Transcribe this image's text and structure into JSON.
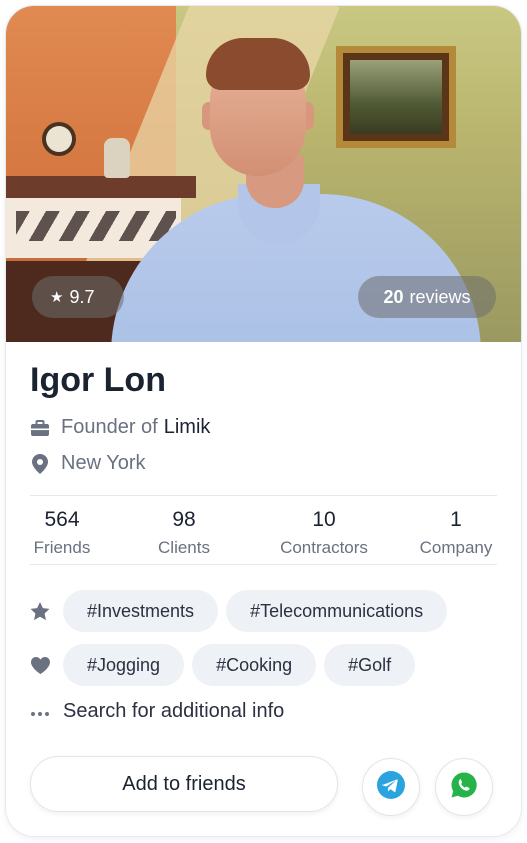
{
  "profile": {
    "rating": "9.7",
    "reviews_count": "20",
    "reviews_label": "reviews",
    "name": "Igor Lon",
    "role_prefix": "Founder of",
    "company": "Limik",
    "location": "New York"
  },
  "stats": [
    {
      "value": "564",
      "label": "Friends"
    },
    {
      "value": "98",
      "label": "Clients"
    },
    {
      "value": "10",
      "label": "Contractors"
    },
    {
      "value": "1",
      "label": "Company"
    }
  ],
  "interests": [
    "#Investments",
    "#Telecommunications"
  ],
  "hobbies": [
    "#Jogging",
    "#Cooking",
    "#Golf"
  ],
  "more_info_label": "Search for additional info",
  "actions": {
    "add_friend_label": "Add to friends"
  },
  "icons": {
    "rating": "star-icon",
    "work": "briefcase-icon",
    "location": "location-pin-icon",
    "interests": "star-icon",
    "hobbies": "heart-icon",
    "more": "ellipsis-icon",
    "telegram": "telegram-icon",
    "whatsapp": "whatsapp-icon"
  },
  "colors": {
    "telegram": "#2aa3de",
    "whatsapp": "#25b34a",
    "muted_text": "#6a7180",
    "tag_bg": "#eef1f5"
  }
}
